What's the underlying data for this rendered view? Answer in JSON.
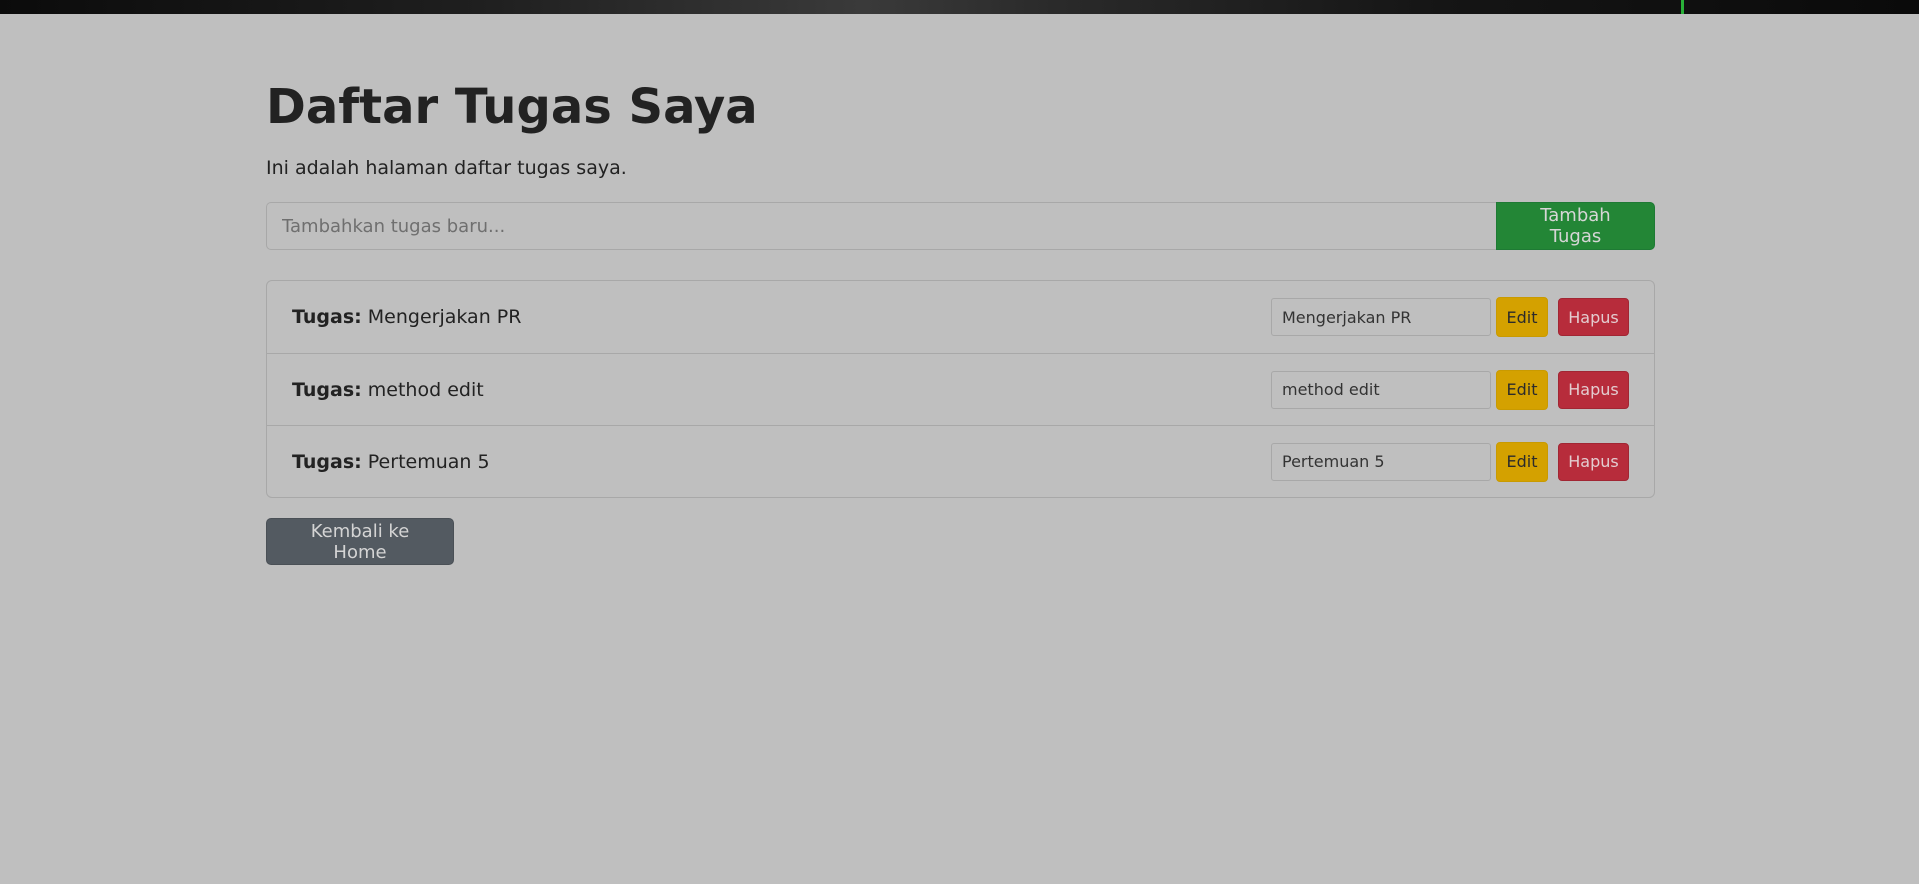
{
  "page": {
    "title": "Daftar Tugas Saya",
    "description": "Ini adalah halaman daftar tugas saya."
  },
  "add_task": {
    "placeholder": "Tambahkan tugas baru...",
    "value": "",
    "button_label": "Tambah Tugas"
  },
  "tasks": [
    {
      "prefix": "Tugas:",
      "name": "Mengerjakan PR",
      "edit_value": "Mengerjakan PR",
      "edit_label": "Edit",
      "delete_label": "Hapus"
    },
    {
      "prefix": "Tugas:",
      "name": "method edit",
      "edit_value": "method edit",
      "edit_label": "Edit",
      "delete_label": "Hapus"
    },
    {
      "prefix": "Tugas:",
      "name": "Pertemuan 5",
      "edit_value": "Pertemuan 5",
      "edit_label": "Edit",
      "delete_label": "Hapus"
    }
  ],
  "footer": {
    "home_button_label": "Kembali ke Home"
  },
  "colors": {
    "background": "#bfbfbf",
    "success": "#238636",
    "warning": "#d4a100",
    "danger": "#b72c3b",
    "secondary": "#535a61"
  }
}
